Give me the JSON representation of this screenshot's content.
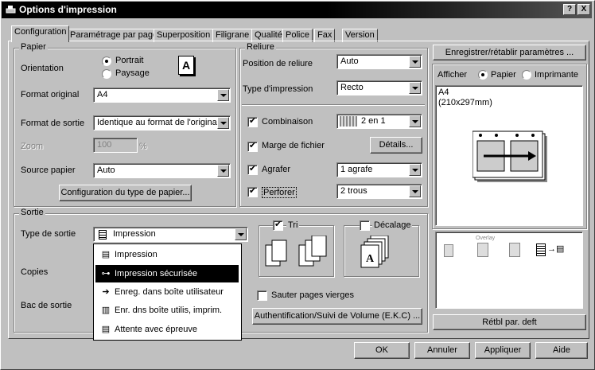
{
  "window": {
    "title": "Options d'impression",
    "help_btn": "?",
    "close_btn": "X"
  },
  "tabs": [
    "Configuration",
    "Paramétrage par page",
    "Superposition",
    "Filigrane",
    "Qualité",
    "Police",
    "Fax",
    "Version"
  ],
  "papier": {
    "title": "Papier",
    "orientation_label": "Orientation",
    "portrait": "Portrait",
    "paysage": "Paysage",
    "orient_glyph": "A",
    "format_original_label": "Format original",
    "format_original_value": "A4",
    "format_sortie_label": "Format de sortie",
    "format_sortie_value": "Identique au format de l'original",
    "zoom_label": "Zoom",
    "zoom_value": "100",
    "zoom_unit": "%",
    "source_label": "Source papier",
    "source_value": "Auto",
    "config_btn": "Configuration du type de papier..."
  },
  "reliure": {
    "title": "Reliure",
    "position_label": "Position de reliure",
    "position_value": "Auto",
    "type_label": "Type d'impression",
    "type_value": "Recto",
    "combinaison_label": "Combinaison",
    "combinaison_value": "2 en 1",
    "marge_label": "Marge de fichier",
    "details_btn": "Détails...",
    "agrafer_label": "Agrafer",
    "agrafer_value": "1 agrafe",
    "perforer_label": "Perforer",
    "perforer_value": "2 trous"
  },
  "sortie": {
    "title": "Sortie",
    "type_label": "Type de sortie",
    "type_value": "Impression",
    "copies_label": "Copies",
    "bac_label": "Bac de sortie",
    "dropdown_items": [
      "Impression",
      "Impression sécurisée",
      "Enreg. dans boîte utilisateur",
      "Enr. dns boîte utilis, imprim.",
      "Attente avec épreuve"
    ],
    "tri_label": "Tri",
    "decalage_label": "Décalage",
    "sauter_label": "Sauter pages vierges",
    "auth_btn": "Authentification/Suivi de Volume (E.K.C) ..."
  },
  "right": {
    "save_btn": "Enregistrer/rétablir paramètres ...",
    "afficher_label": "Afficher",
    "papier_radio": "Papier",
    "imprimante_radio": "Imprimante",
    "paper_size": "A4",
    "paper_dims": "(210x297mm)",
    "overlay_caption": "Overlay",
    "reset_btn": "Rétbl par. deft"
  },
  "footer": {
    "ok": "OK",
    "annuler": "Annuler",
    "appliquer": "Appliquer",
    "aide": "Aide"
  }
}
